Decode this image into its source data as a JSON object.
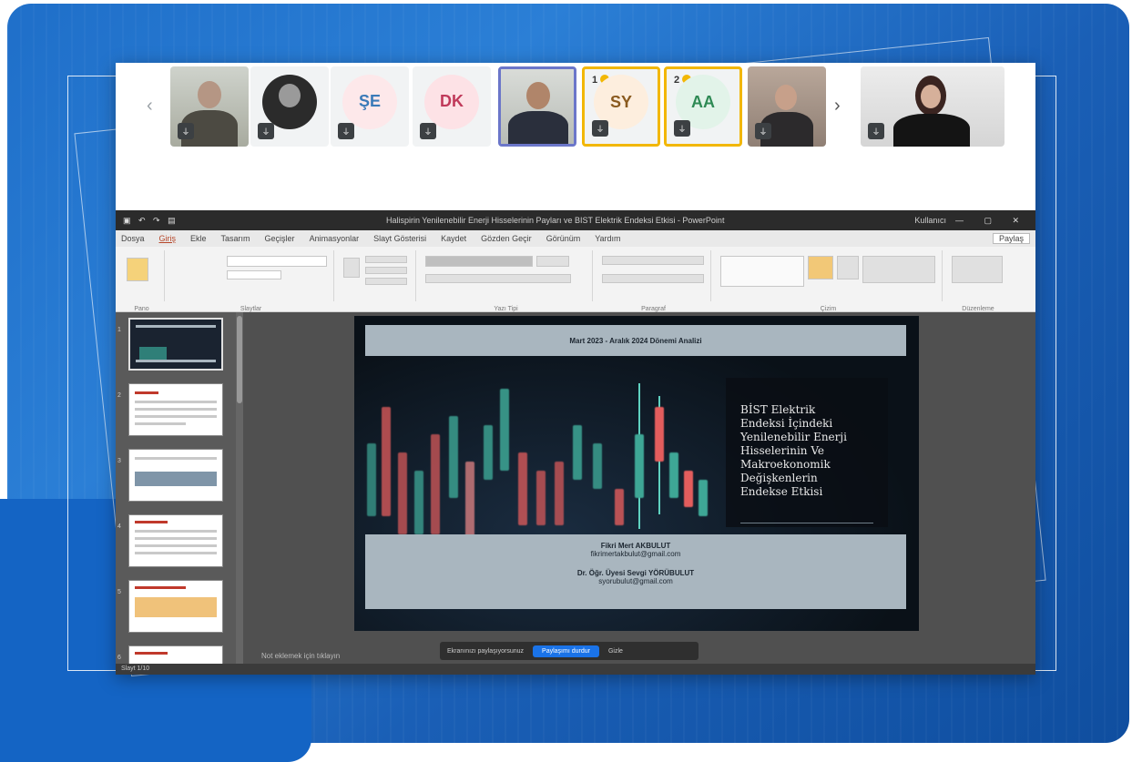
{
  "meeting": {
    "participants": [
      {
        "type": "video",
        "muted": true
      },
      {
        "type": "avatar-photo",
        "muted": true
      },
      {
        "type": "initials",
        "initials": "ŞE",
        "bg": "#fde8ea",
        "fg": "#3a7ab8",
        "muted": true
      },
      {
        "type": "initials",
        "initials": "DK",
        "bg": "#fde2e6",
        "fg": "#c0395a",
        "muted": true
      },
      {
        "type": "video",
        "muted": false,
        "active": true
      },
      {
        "type": "initials",
        "initials": "SY",
        "bg": "#fdeede",
        "fg": "#8a5a1f",
        "muted": true,
        "hand_order": "1"
      },
      {
        "type": "initials",
        "initials": "AA",
        "bg": "#e2f3e9",
        "fg": "#2f8a55",
        "muted": true,
        "hand_order": "2"
      },
      {
        "type": "video",
        "muted": true
      },
      {
        "type": "video",
        "muted": true
      }
    ],
    "nav_prev": "‹",
    "nav_next": "›",
    "mic_glyph": "⏚",
    "accent_hand": "#f2b705"
  },
  "powerpoint": {
    "title_bar": {
      "doc_title": "Halispirin Yenilenebilir Enerji Hisselerinin Payları ve BIST Elektrik Endeksi Etkisi - PowerPoint",
      "user": "Kullanıcı"
    },
    "tabs": [
      "Dosya",
      "Giriş",
      "Ekle",
      "Tasarım",
      "Geçişler",
      "Animasyonlar",
      "Slayt Gösterisi",
      "Kaydet",
      "Gözden Geçir",
      "Görünüm",
      "Yardım"
    ],
    "active_tab": "Giriş",
    "share_label": "Paylaş",
    "ribbon_groups": [
      "Pano",
      "Slaytlar",
      "Yazı Tipi",
      "Paragraf",
      "Çizim",
      "Düzenleme"
    ],
    "notes_hint": "Not eklemek için tıklayın",
    "status_text": "Slayt 1/10",
    "thumbnail_count": 6,
    "present_bar": {
      "message": "Ekranınızı paylaşıyorsunuz",
      "stop_label": "Paylaşımı durdur",
      "hide_label": "Gizle"
    }
  },
  "slide": {
    "header": "Mart 2023 - Aralık 2024 Dönemi Analizi",
    "title_lines": [
      "BİST Elektrik",
      "Endeksi İçindeki",
      "Yenilenebilir Enerji",
      "Hisselerinin Ve",
      "Makroekonomik",
      "Değişkenlerin",
      "Endekse Etkisi"
    ],
    "author1": "Fikri Mert AKBULUT",
    "email1": "fikrimertakbulut@gmail.com",
    "author2": "Dr. Öğr. Üyesi Sevgi YÖRÜBULUT",
    "email2": "syorubulut@gmail.com"
  }
}
